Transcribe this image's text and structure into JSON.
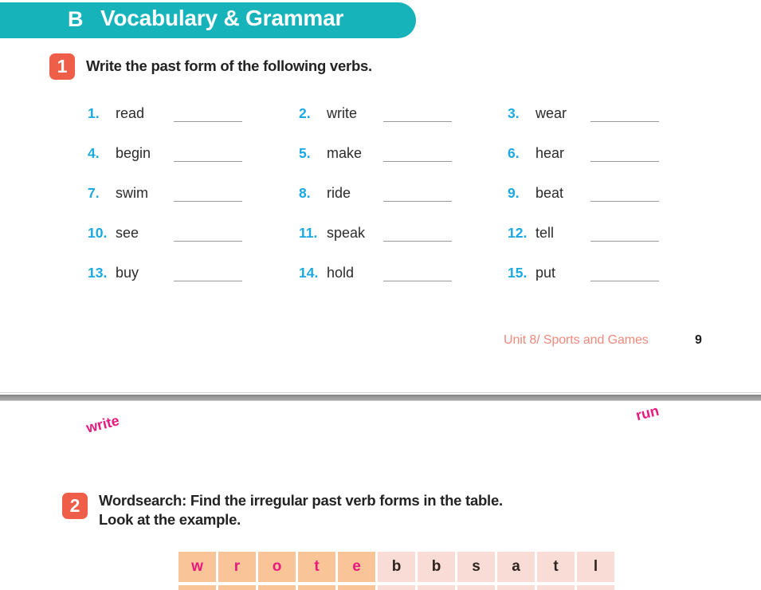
{
  "page_one": {
    "section": {
      "letter": "B",
      "title": "Vocabulary & Grammar",
      "banner_color": "#16b3bb"
    },
    "exercise_1": {
      "number": "1",
      "badge_color": "#ef5e48",
      "instruction": "Write the past form of the following verbs.",
      "number_color": "#1aa9e2",
      "items": [
        {
          "num": "1.",
          "verb": "read"
        },
        {
          "num": "2.",
          "verb": "write"
        },
        {
          "num": "3.",
          "verb": "wear"
        },
        {
          "num": "4.",
          "verb": "begin"
        },
        {
          "num": "5.",
          "verb": "make"
        },
        {
          "num": "6.",
          "verb": "hear"
        },
        {
          "num": "7.",
          "verb": "swim"
        },
        {
          "num": "8.",
          "verb": "ride"
        },
        {
          "num": "9.",
          "verb": "beat"
        },
        {
          "num": "10.",
          "verb": "see"
        },
        {
          "num": "11.",
          "verb": "speak"
        },
        {
          "num": "12.",
          "verb": "tell"
        },
        {
          "num": "13.",
          "verb": "buy"
        },
        {
          "num": "14.",
          "verb": "hold"
        },
        {
          "num": "15.",
          "verb": "put"
        }
      ]
    },
    "footer": {
      "unit": "Unit 8/ Sports and Games",
      "page_number": "9",
      "unit_color": "#ef8a7c"
    }
  },
  "page_two": {
    "exercise_2": {
      "number": "2",
      "badge_color": "#ef5e48",
      "instruction_line_1": "Wordsearch: Find the irregular past verb forms in the table.",
      "instruction_line_2": "Look at the example.",
      "clue_left": "write",
      "clue_right": "run",
      "clue_color": "#e8197e",
      "grid_row": [
        {
          "letter": "w",
          "found": true
        },
        {
          "letter": "r",
          "found": true
        },
        {
          "letter": "o",
          "found": true
        },
        {
          "letter": "t",
          "found": true
        },
        {
          "letter": "e",
          "found": true
        },
        {
          "letter": "b",
          "found": false
        },
        {
          "letter": "b",
          "found": false
        },
        {
          "letter": "s",
          "found": false
        },
        {
          "letter": "a",
          "found": false
        },
        {
          "letter": "t",
          "found": false
        },
        {
          "letter": "l",
          "found": false
        }
      ],
      "found_cell_color": "#f8c498",
      "plain_cell_color": "#fadcd6"
    }
  }
}
